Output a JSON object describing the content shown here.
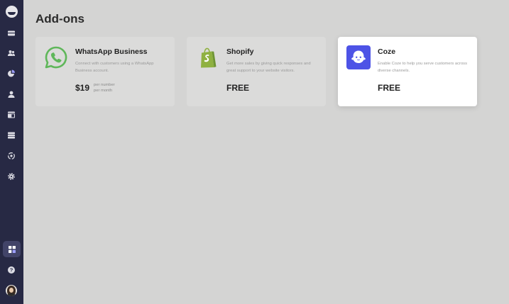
{
  "page": {
    "title": "Add-ons"
  },
  "sidebar": {
    "items": [
      {
        "name": "inbox"
      },
      {
        "name": "contacts"
      },
      {
        "name": "reports"
      },
      {
        "name": "agents"
      },
      {
        "name": "widgets"
      },
      {
        "name": "database"
      },
      {
        "name": "integrations"
      },
      {
        "name": "settings"
      }
    ],
    "active": "add-ons",
    "bottom": [
      "help",
      "profile"
    ]
  },
  "addons": [
    {
      "title": "WhatsApp Business",
      "description": "Connect with customers using a WhatsApp Business account.",
      "price": "$19",
      "price_note_line1": "per number",
      "price_note_line2": "per month",
      "icon": "whatsapp-icon"
    },
    {
      "title": "Shopify",
      "description": "Get more sales by giving quick responses and great support to your website visitors.",
      "price": "FREE",
      "icon": "shopify-icon"
    },
    {
      "title": "Coze",
      "description": "Enable Coze to help you serve customers across diverse channels.",
      "price": "FREE",
      "icon": "coze-icon"
    }
  ],
  "colors": {
    "sidebar_bg": "#272944",
    "page_bg": "#d4d4d3",
    "whatsapp": "#5fb75a",
    "shopify": "#8fb140",
    "coze": "#4d53e6"
  }
}
